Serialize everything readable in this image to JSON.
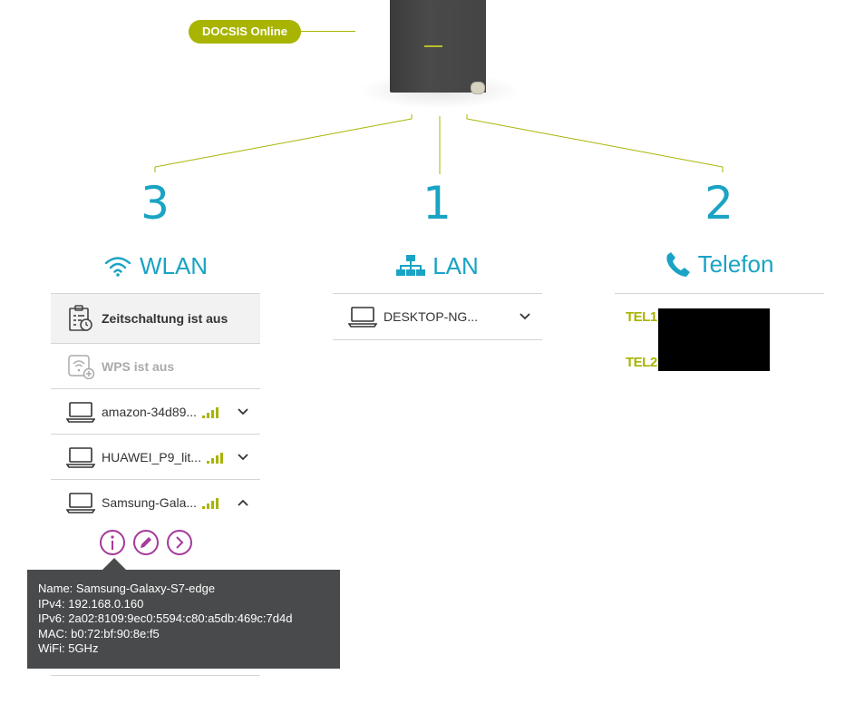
{
  "status": {
    "badge": "DOCSIS Online"
  },
  "columns": {
    "wlan": {
      "count": "3",
      "title": "WLAN"
    },
    "lan": {
      "count": "1",
      "title": "LAN"
    },
    "telefon": {
      "count": "2",
      "title": "Telefon"
    }
  },
  "wlan": {
    "schedule_label": "Zeitschaltung ist aus",
    "wps_label": "WPS ist aus",
    "devices": [
      {
        "name": "amazon-34d89..."
      },
      {
        "name": "HUAWEI_P9_lit..."
      },
      {
        "name": "Samsung-Gala..."
      }
    ]
  },
  "lan": {
    "devices": [
      {
        "name": "DESKTOP-NG..."
      }
    ]
  },
  "telefon": {
    "lines": [
      "TEL1",
      "TEL2"
    ]
  },
  "tooltip": {
    "name": "Name: Samsung-Galaxy-S7-edge",
    "ipv4": "IPv4: 192.168.0.160",
    "ipv6": "IPv6: 2a02:8109:9ec0:5594:c80:a5db:469c:7d4d",
    "mac": "MAC: b0:72:bf:90:8e:f5",
    "wifi": "WiFi: 5GHz"
  },
  "colors": {
    "accent_blue": "#1aa3c4",
    "accent_green": "#a8b400",
    "action_purple": "#a53a9a",
    "tooltip_bg": "#484a4b"
  },
  "icons": {
    "schedule": "clipboard-clock-icon",
    "wps": "wps-icon",
    "device": "laptop-icon",
    "signal": "signal-bars-icon",
    "info": "info-icon",
    "edit": "pencil-icon",
    "forward": "chevron-right-icon"
  }
}
